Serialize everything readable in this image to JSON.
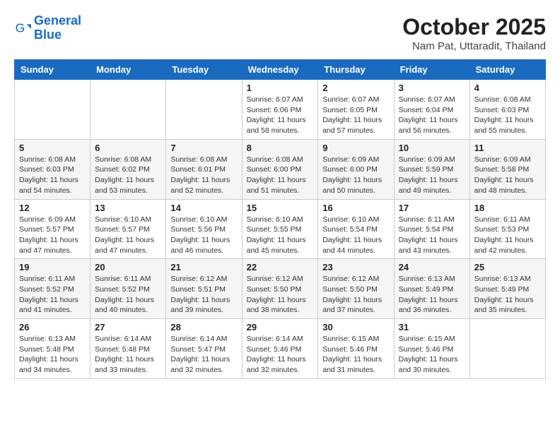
{
  "logo": {
    "line1": "General",
    "line2": "Blue"
  },
  "title": "October 2025",
  "subtitle": "Nam Pat, Uttaradit, Thailand",
  "days_header": [
    "Sunday",
    "Monday",
    "Tuesday",
    "Wednesday",
    "Thursday",
    "Friday",
    "Saturday"
  ],
  "weeks": [
    [
      {
        "day": "",
        "info": ""
      },
      {
        "day": "",
        "info": ""
      },
      {
        "day": "",
        "info": ""
      },
      {
        "day": "1",
        "info": "Sunrise: 6:07 AM\nSunset: 6:06 PM\nDaylight: 11 hours\nand 58 minutes."
      },
      {
        "day": "2",
        "info": "Sunrise: 6:07 AM\nSunset: 6:05 PM\nDaylight: 11 hours\nand 57 minutes."
      },
      {
        "day": "3",
        "info": "Sunrise: 6:07 AM\nSunset: 6:04 PM\nDaylight: 11 hours\nand 56 minutes."
      },
      {
        "day": "4",
        "info": "Sunrise: 6:08 AM\nSunset: 6:03 PM\nDaylight: 11 hours\nand 55 minutes."
      }
    ],
    [
      {
        "day": "5",
        "info": "Sunrise: 6:08 AM\nSunset: 6:03 PM\nDaylight: 11 hours\nand 54 minutes."
      },
      {
        "day": "6",
        "info": "Sunrise: 6:08 AM\nSunset: 6:02 PM\nDaylight: 11 hours\nand 53 minutes."
      },
      {
        "day": "7",
        "info": "Sunrise: 6:08 AM\nSunset: 6:01 PM\nDaylight: 11 hours\nand 52 minutes."
      },
      {
        "day": "8",
        "info": "Sunrise: 6:08 AM\nSunset: 6:00 PM\nDaylight: 11 hours\nand 51 minutes."
      },
      {
        "day": "9",
        "info": "Sunrise: 6:09 AM\nSunset: 6:00 PM\nDaylight: 11 hours\nand 50 minutes."
      },
      {
        "day": "10",
        "info": "Sunrise: 6:09 AM\nSunset: 5:59 PM\nDaylight: 11 hours\nand 49 minutes."
      },
      {
        "day": "11",
        "info": "Sunrise: 6:09 AM\nSunset: 5:58 PM\nDaylight: 11 hours\nand 48 minutes."
      }
    ],
    [
      {
        "day": "12",
        "info": "Sunrise: 6:09 AM\nSunset: 5:57 PM\nDaylight: 11 hours\nand 47 minutes."
      },
      {
        "day": "13",
        "info": "Sunrise: 6:10 AM\nSunset: 5:57 PM\nDaylight: 11 hours\nand 47 minutes."
      },
      {
        "day": "14",
        "info": "Sunrise: 6:10 AM\nSunset: 5:56 PM\nDaylight: 11 hours\nand 46 minutes."
      },
      {
        "day": "15",
        "info": "Sunrise: 6:10 AM\nSunset: 5:55 PM\nDaylight: 11 hours\nand 45 minutes."
      },
      {
        "day": "16",
        "info": "Sunrise: 6:10 AM\nSunset: 5:54 PM\nDaylight: 11 hours\nand 44 minutes."
      },
      {
        "day": "17",
        "info": "Sunrise: 6:11 AM\nSunset: 5:54 PM\nDaylight: 11 hours\nand 43 minutes."
      },
      {
        "day": "18",
        "info": "Sunrise: 6:11 AM\nSunset: 5:53 PM\nDaylight: 11 hours\nand 42 minutes."
      }
    ],
    [
      {
        "day": "19",
        "info": "Sunrise: 6:11 AM\nSunset: 5:52 PM\nDaylight: 11 hours\nand 41 minutes."
      },
      {
        "day": "20",
        "info": "Sunrise: 6:11 AM\nSunset: 5:52 PM\nDaylight: 11 hours\nand 40 minutes."
      },
      {
        "day": "21",
        "info": "Sunrise: 6:12 AM\nSunset: 5:51 PM\nDaylight: 11 hours\nand 39 minutes."
      },
      {
        "day": "22",
        "info": "Sunrise: 6:12 AM\nSunset: 5:50 PM\nDaylight: 11 hours\nand 38 minutes."
      },
      {
        "day": "23",
        "info": "Sunrise: 6:12 AM\nSunset: 5:50 PM\nDaylight: 11 hours\nand 37 minutes."
      },
      {
        "day": "24",
        "info": "Sunrise: 6:13 AM\nSunset: 5:49 PM\nDaylight: 11 hours\nand 36 minutes."
      },
      {
        "day": "25",
        "info": "Sunrise: 6:13 AM\nSunset: 5:49 PM\nDaylight: 11 hours\nand 35 minutes."
      }
    ],
    [
      {
        "day": "26",
        "info": "Sunrise: 6:13 AM\nSunset: 5:48 PM\nDaylight: 11 hours\nand 34 minutes."
      },
      {
        "day": "27",
        "info": "Sunrise: 6:14 AM\nSunset: 5:48 PM\nDaylight: 11 hours\nand 33 minutes."
      },
      {
        "day": "28",
        "info": "Sunrise: 6:14 AM\nSunset: 5:47 PM\nDaylight: 11 hours\nand 32 minutes."
      },
      {
        "day": "29",
        "info": "Sunrise: 6:14 AM\nSunset: 5:46 PM\nDaylight: 11 hours\nand 32 minutes."
      },
      {
        "day": "30",
        "info": "Sunrise: 6:15 AM\nSunset: 5:46 PM\nDaylight: 11 hours\nand 31 minutes."
      },
      {
        "day": "31",
        "info": "Sunrise: 6:15 AM\nSunset: 5:46 PM\nDaylight: 11 hours\nand 30 minutes."
      },
      {
        "day": "",
        "info": ""
      }
    ]
  ]
}
